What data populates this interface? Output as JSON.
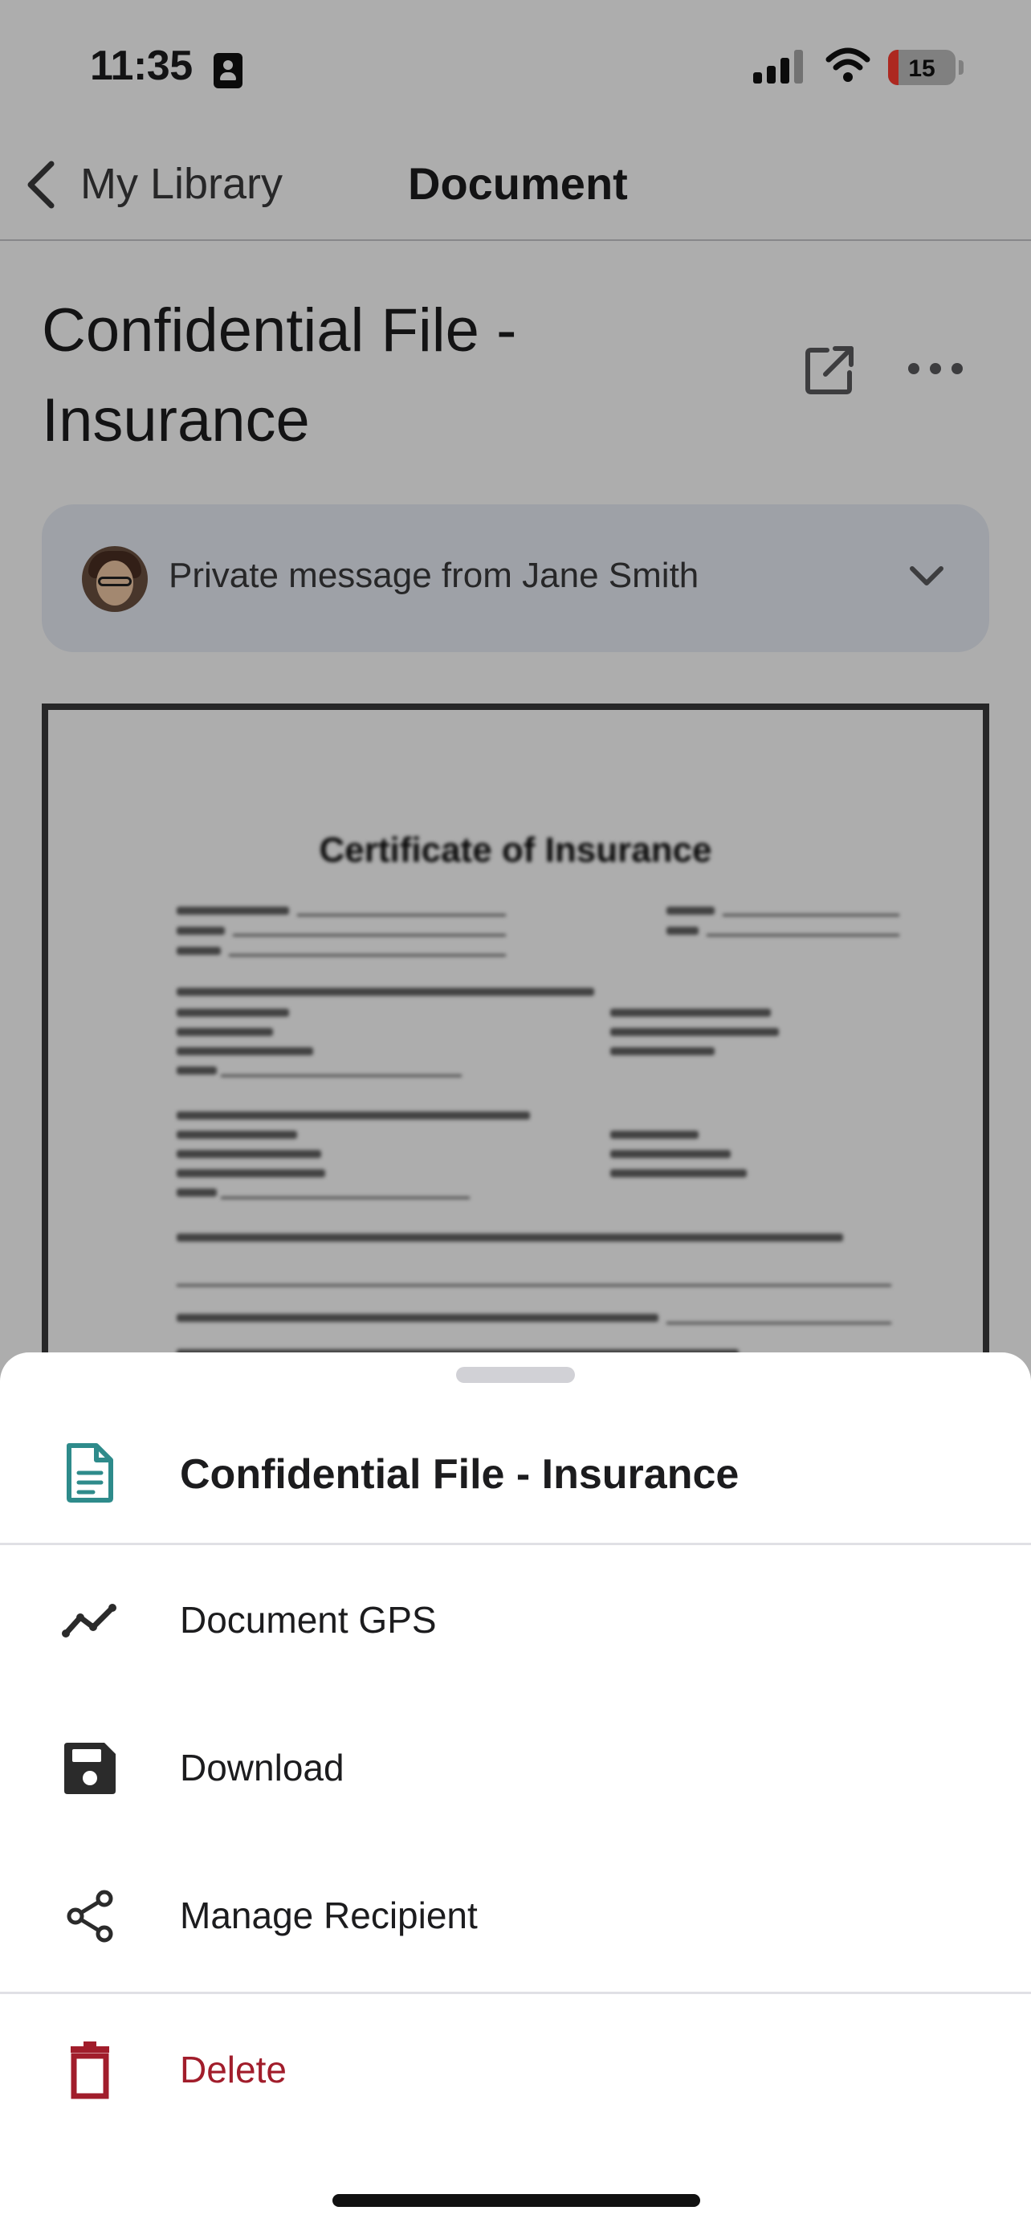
{
  "status_bar": {
    "time": "11:35",
    "battery_percent": "15",
    "battery_level": 0.15
  },
  "nav": {
    "back_label": "My Library",
    "title": "Document"
  },
  "document": {
    "title": "Confidential File - Insurance",
    "message": "Private message from Jane Smith",
    "preview_title": "Certificate of Insurance"
  },
  "sheet": {
    "title": "Confidential File - Insurance",
    "items": [
      {
        "label": "Document GPS",
        "icon": "trend-line-icon"
      },
      {
        "label": "Download",
        "icon": "floppy-disk-icon"
      },
      {
        "label": "Manage Recipient",
        "icon": "share-icon"
      },
      {
        "label": "Delete",
        "icon": "trash-icon"
      }
    ]
  },
  "colors": {
    "accent_teal": "#2e8b8b",
    "danger": "#a11d2b",
    "card_bg": "#e9edf6"
  }
}
